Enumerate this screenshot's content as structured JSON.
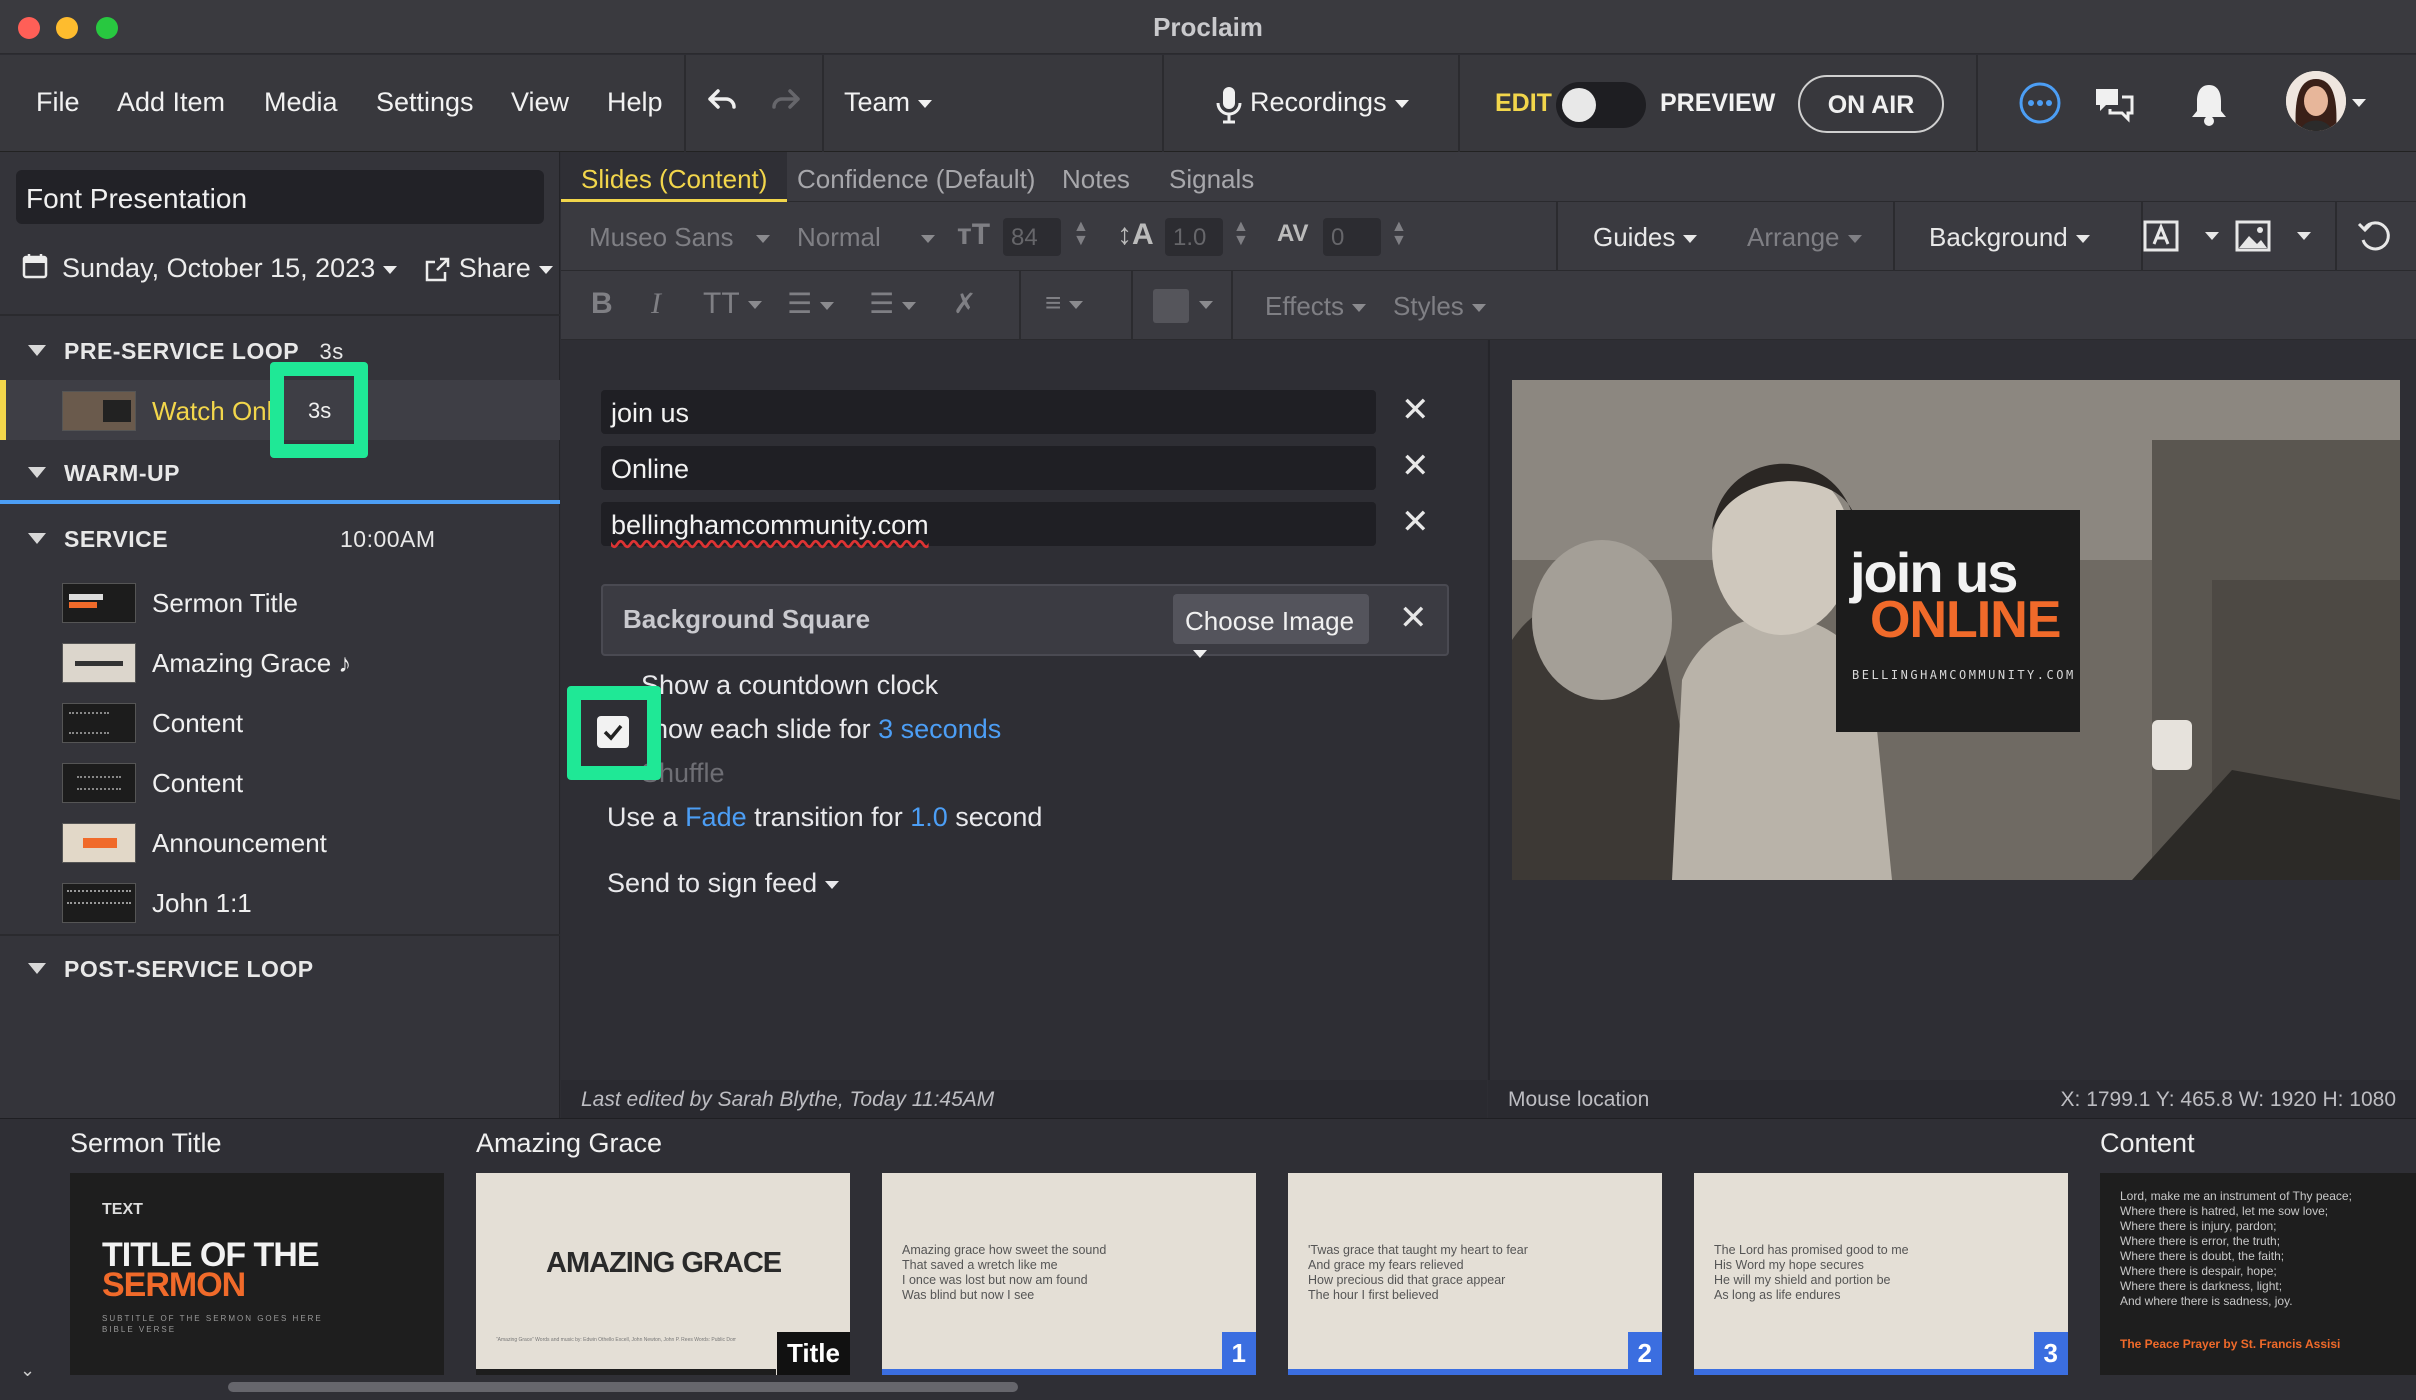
{
  "window": {
    "title": "Proclaim"
  },
  "menu": {
    "file": "File",
    "add_item": "Add Item",
    "media": "Media",
    "settings": "Settings",
    "view": "View",
    "help": "Help",
    "team": "Team",
    "recordings": "Recordings",
    "edit": "EDIT",
    "preview": "PREVIEW",
    "on_air": "ON AIR"
  },
  "presentation": {
    "name": "Font Presentation",
    "date": "Sunday, October 15, 2023",
    "share": "Share"
  },
  "sections": {
    "pre_service": {
      "label": "PRE-SERVICE LOOP",
      "duration": "3s",
      "item": {
        "label": "Watch Onli",
        "duration": "3s"
      }
    },
    "warm_up": {
      "label": "WARM-UP"
    },
    "service": {
      "label": "SERVICE",
      "time": "10:00AM",
      "items": [
        {
          "label": "Sermon Title"
        },
        {
          "label": "Amazing Grace ♪"
        },
        {
          "label": "Content"
        },
        {
          "label": "Content"
        },
        {
          "label": "Announcement"
        },
        {
          "label": "John 1:1"
        }
      ]
    },
    "post_service": {
      "label": "POST-SERVICE LOOP"
    }
  },
  "tabs": {
    "slides": "Slides (Content)",
    "confidence": "Confidence (Default)",
    "notes": "Notes",
    "signals": "Signals"
  },
  "toolbar": {
    "font": "Museo Sans",
    "weight": "Normal",
    "size": "84",
    "line_height": "1.0",
    "tracking": "0",
    "guides": "Guides",
    "arrange": "Arrange",
    "background": "Background",
    "effects": "Effects",
    "styles": "Styles"
  },
  "editor": {
    "lines": [
      "join us",
      "Online",
      "bellinghamcommunity.com"
    ],
    "bg_square_label": "Background Square",
    "choose_image": "Choose Image",
    "countdown": "Show a countdown clock",
    "each_slide_pre": "how each slide for",
    "each_slide_link": "3 seconds",
    "shuffle": "Shuffle",
    "transition_pre": "Use a",
    "transition_type": "Fade",
    "transition_mid": "transition for",
    "transition_dur": "1.0",
    "transition_post": "second",
    "sign_feed": "Send to sign feed",
    "each_slide_checked": true
  },
  "preview_slide": {
    "line1": "join us",
    "line2": "ONLINE",
    "line3": "BELLINGHAMCOMMUNITY.COM"
  },
  "status": {
    "last_edited": "Last edited by Sarah Blythe, Today 11:45AM",
    "mouse_label": "Mouse location",
    "coords": "X: 1799.1  Y: 465.8    W: 1920  H: 1080"
  },
  "strip": {
    "groups": [
      "Sermon Title",
      "Amazing Grace",
      "Content"
    ],
    "sermon": {
      "text": "TEXT",
      "title1": "TITLE OF THE",
      "title2": "SERMON",
      "sub": "SUBTITLE OF THE SERMON GOES HERE\nBIBLE VERSE"
    },
    "amazing": {
      "title": "AMAZING GRACE",
      "credit": "“Amazing Grace” Words and music by: Edwin Othello Excell, John Newton, John P. Rees Words: Public Domain. Words © 2023",
      "badge": "Title"
    },
    "verses": [
      {
        "text": "Amazing grace how sweet the sound\nThat saved a wretch like me\nI once was lost but now am found\nWas blind but now I see",
        "badge": "1"
      },
      {
        "text": "'Twas grace that taught my heart to fear\nAnd grace my fears relieved\nHow precious did that grace appear\nThe hour I first believed",
        "badge": "2"
      },
      {
        "text": "The Lord has promised good to me\nHis Word my hope secures\nHe will my shield and portion be\nAs long as life endures",
        "badge": "3"
      }
    ],
    "prayer": {
      "text": "Lord, make me an instrument of Thy peace;\nWhere there is hatred, let me sow love;\nWhere there is injury, pardon;\nWhere there is error, the truth;\nWhere there is doubt, the faith;\nWhere there is despair, hope;\nWhere there is darkness, light;\nAnd where there is sadness, joy.",
      "credit": "The Peace Prayer by St. Francis Assisi"
    }
  },
  "colors": {
    "accent_yellow": "#f2d64b",
    "link_blue": "#4c9ef5",
    "highlight_green": "#1fe896",
    "badge_blue": "#3b6ee0",
    "orange": "#f06a2a"
  }
}
